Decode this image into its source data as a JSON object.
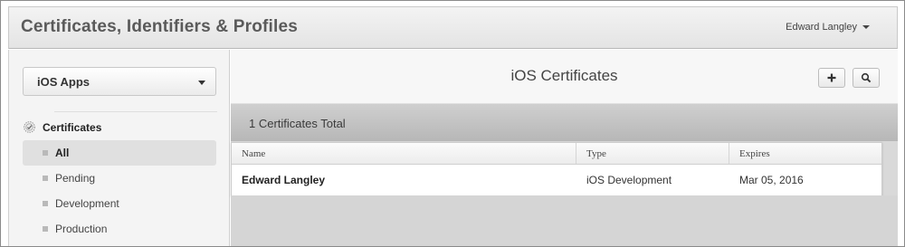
{
  "header": {
    "title": "Certificates, Identifiers & Profiles",
    "user_name": "Edward Langley"
  },
  "sidebar": {
    "platform_select": "iOS Apps",
    "section_title": "Certificates",
    "items": [
      {
        "label": "All",
        "active": true
      },
      {
        "label": "Pending",
        "active": false
      },
      {
        "label": "Development",
        "active": false
      },
      {
        "label": "Production",
        "active": false
      }
    ]
  },
  "main": {
    "title": "iOS Certificates",
    "total_label": "1 Certificates Total",
    "table": {
      "columns": [
        "Name",
        "Type",
        "Expires"
      ],
      "rows": [
        {
          "name": "Edward Langley",
          "type": "iOS Development",
          "expires": "Mar 05, 2016"
        }
      ]
    }
  },
  "icons": {
    "add": "plus-icon",
    "search": "search-icon",
    "certificate": "certificate-icon"
  },
  "colors": {
    "header_bg": "#e9e9e9",
    "sidebar_bg": "#f4f4f4",
    "total_bar_bg": "#c3c3c3",
    "active_item_bg": "#e0e0e0"
  }
}
